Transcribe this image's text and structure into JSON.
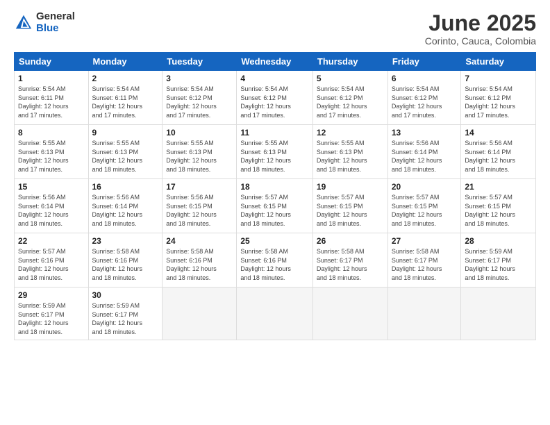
{
  "logo": {
    "general": "General",
    "blue": "Blue"
  },
  "title": "June 2025",
  "subtitle": "Corinto, Cauca, Colombia",
  "weekdays": [
    "Sunday",
    "Monday",
    "Tuesday",
    "Wednesday",
    "Thursday",
    "Friday",
    "Saturday"
  ],
  "weeks": [
    [
      {
        "day": "1",
        "info": "Sunrise: 5:54 AM\nSunset: 6:11 PM\nDaylight: 12 hours\nand 17 minutes."
      },
      {
        "day": "2",
        "info": "Sunrise: 5:54 AM\nSunset: 6:11 PM\nDaylight: 12 hours\nand 17 minutes."
      },
      {
        "day": "3",
        "info": "Sunrise: 5:54 AM\nSunset: 6:12 PM\nDaylight: 12 hours\nand 17 minutes."
      },
      {
        "day": "4",
        "info": "Sunrise: 5:54 AM\nSunset: 6:12 PM\nDaylight: 12 hours\nand 17 minutes."
      },
      {
        "day": "5",
        "info": "Sunrise: 5:54 AM\nSunset: 6:12 PM\nDaylight: 12 hours\nand 17 minutes."
      },
      {
        "day": "6",
        "info": "Sunrise: 5:54 AM\nSunset: 6:12 PM\nDaylight: 12 hours\nand 17 minutes."
      },
      {
        "day": "7",
        "info": "Sunrise: 5:54 AM\nSunset: 6:12 PM\nDaylight: 12 hours\nand 17 minutes."
      }
    ],
    [
      {
        "day": "8",
        "info": "Sunrise: 5:55 AM\nSunset: 6:13 PM\nDaylight: 12 hours\nand 17 minutes."
      },
      {
        "day": "9",
        "info": "Sunrise: 5:55 AM\nSunset: 6:13 PM\nDaylight: 12 hours\nand 18 minutes."
      },
      {
        "day": "10",
        "info": "Sunrise: 5:55 AM\nSunset: 6:13 PM\nDaylight: 12 hours\nand 18 minutes."
      },
      {
        "day": "11",
        "info": "Sunrise: 5:55 AM\nSunset: 6:13 PM\nDaylight: 12 hours\nand 18 minutes."
      },
      {
        "day": "12",
        "info": "Sunrise: 5:55 AM\nSunset: 6:13 PM\nDaylight: 12 hours\nand 18 minutes."
      },
      {
        "day": "13",
        "info": "Sunrise: 5:56 AM\nSunset: 6:14 PM\nDaylight: 12 hours\nand 18 minutes."
      },
      {
        "day": "14",
        "info": "Sunrise: 5:56 AM\nSunset: 6:14 PM\nDaylight: 12 hours\nand 18 minutes."
      }
    ],
    [
      {
        "day": "15",
        "info": "Sunrise: 5:56 AM\nSunset: 6:14 PM\nDaylight: 12 hours\nand 18 minutes."
      },
      {
        "day": "16",
        "info": "Sunrise: 5:56 AM\nSunset: 6:14 PM\nDaylight: 12 hours\nand 18 minutes."
      },
      {
        "day": "17",
        "info": "Sunrise: 5:56 AM\nSunset: 6:15 PM\nDaylight: 12 hours\nand 18 minutes."
      },
      {
        "day": "18",
        "info": "Sunrise: 5:57 AM\nSunset: 6:15 PM\nDaylight: 12 hours\nand 18 minutes."
      },
      {
        "day": "19",
        "info": "Sunrise: 5:57 AM\nSunset: 6:15 PM\nDaylight: 12 hours\nand 18 minutes."
      },
      {
        "day": "20",
        "info": "Sunrise: 5:57 AM\nSunset: 6:15 PM\nDaylight: 12 hours\nand 18 minutes."
      },
      {
        "day": "21",
        "info": "Sunrise: 5:57 AM\nSunset: 6:15 PM\nDaylight: 12 hours\nand 18 minutes."
      }
    ],
    [
      {
        "day": "22",
        "info": "Sunrise: 5:57 AM\nSunset: 6:16 PM\nDaylight: 12 hours\nand 18 minutes."
      },
      {
        "day": "23",
        "info": "Sunrise: 5:58 AM\nSunset: 6:16 PM\nDaylight: 12 hours\nand 18 minutes."
      },
      {
        "day": "24",
        "info": "Sunrise: 5:58 AM\nSunset: 6:16 PM\nDaylight: 12 hours\nand 18 minutes."
      },
      {
        "day": "25",
        "info": "Sunrise: 5:58 AM\nSunset: 6:16 PM\nDaylight: 12 hours\nand 18 minutes."
      },
      {
        "day": "26",
        "info": "Sunrise: 5:58 AM\nSunset: 6:17 PM\nDaylight: 12 hours\nand 18 minutes."
      },
      {
        "day": "27",
        "info": "Sunrise: 5:58 AM\nSunset: 6:17 PM\nDaylight: 12 hours\nand 18 minutes."
      },
      {
        "day": "28",
        "info": "Sunrise: 5:59 AM\nSunset: 6:17 PM\nDaylight: 12 hours\nand 18 minutes."
      }
    ],
    [
      {
        "day": "29",
        "info": "Sunrise: 5:59 AM\nSunset: 6:17 PM\nDaylight: 12 hours\nand 18 minutes."
      },
      {
        "day": "30",
        "info": "Sunrise: 5:59 AM\nSunset: 6:17 PM\nDaylight: 12 hours\nand 18 minutes."
      },
      {
        "day": "",
        "info": ""
      },
      {
        "day": "",
        "info": ""
      },
      {
        "day": "",
        "info": ""
      },
      {
        "day": "",
        "info": ""
      },
      {
        "day": "",
        "info": ""
      }
    ]
  ]
}
